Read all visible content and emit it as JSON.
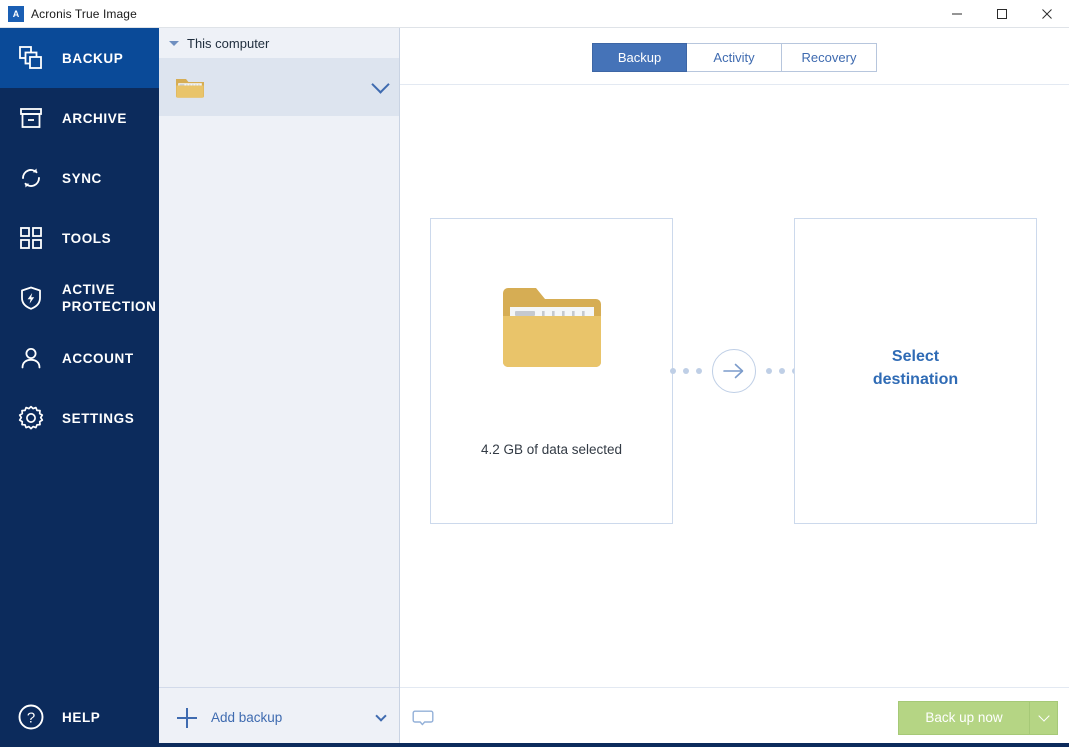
{
  "window": {
    "title": "Acronis True Image",
    "logo_letter": "A",
    "controls": [
      {
        "name": "minimize",
        "icon": "minimize-icon"
      },
      {
        "name": "maximize",
        "icon": "maximize-icon"
      },
      {
        "name": "close",
        "icon": "close-icon"
      }
    ]
  },
  "colors": {
    "sidebar_bg": "#0c2b5c",
    "sidebar_active": "#0a4a98",
    "accent_blue": "#3f6bb0",
    "tab_active": "#4573b8",
    "panel_bg": "#eef1f7",
    "list_item_bg": "#dde4ef",
    "box_border": "#ccd9ec",
    "backup_button": "#b5d584",
    "folder_body": "#e9c46a",
    "folder_tab": "#d6ad54"
  },
  "sidebar": {
    "items": [
      {
        "label": "Backup",
        "icon": "backup-stack-icon",
        "active": true
      },
      {
        "label": "Archive",
        "icon": "archive-box-icon",
        "active": false
      },
      {
        "label": "Sync",
        "icon": "sync-arrows-icon",
        "active": false
      },
      {
        "label": "Tools",
        "icon": "tools-grid-icon",
        "active": false
      },
      {
        "label": "Active\nProtection",
        "label_line1": "Active",
        "label_line2": "Protection",
        "icon": "shield-bolt-icon",
        "active": false
      },
      {
        "label": "Account",
        "icon": "person-icon",
        "active": false
      },
      {
        "label": "Settings",
        "icon": "gear-icon",
        "active": false
      }
    ],
    "help": {
      "label": "Help",
      "icon": "question-circle-icon"
    }
  },
  "backup_list": {
    "group_header": "This computer",
    "group_caret_icon": "caret-down-icon",
    "items": [
      {
        "name": "",
        "icon": "folder-icon",
        "expand_icon": "chevron-down-icon",
        "selected": true
      }
    ],
    "add_backup": {
      "label": "Add backup",
      "plus_icon": "plus-icon",
      "caret_icon": "chevron-down-icon"
    }
  },
  "main": {
    "tabs": [
      {
        "label": "Backup",
        "active": true
      },
      {
        "label": "Activity",
        "active": false
      },
      {
        "label": "Recovery",
        "active": false
      }
    ],
    "source": {
      "icon": "folder-icon",
      "label": "4.2 GB of data selected"
    },
    "connector": {
      "icon": "arrow-right-circle-icon",
      "left_dots": 3,
      "right_dots": 3
    },
    "destination": {
      "line1": "Select",
      "line2": "destination"
    },
    "bottom": {
      "feedback_icon": "speech-bubble-icon",
      "backup_now_label": "Back up now",
      "backup_now_caret_icon": "chevron-down-icon"
    }
  }
}
